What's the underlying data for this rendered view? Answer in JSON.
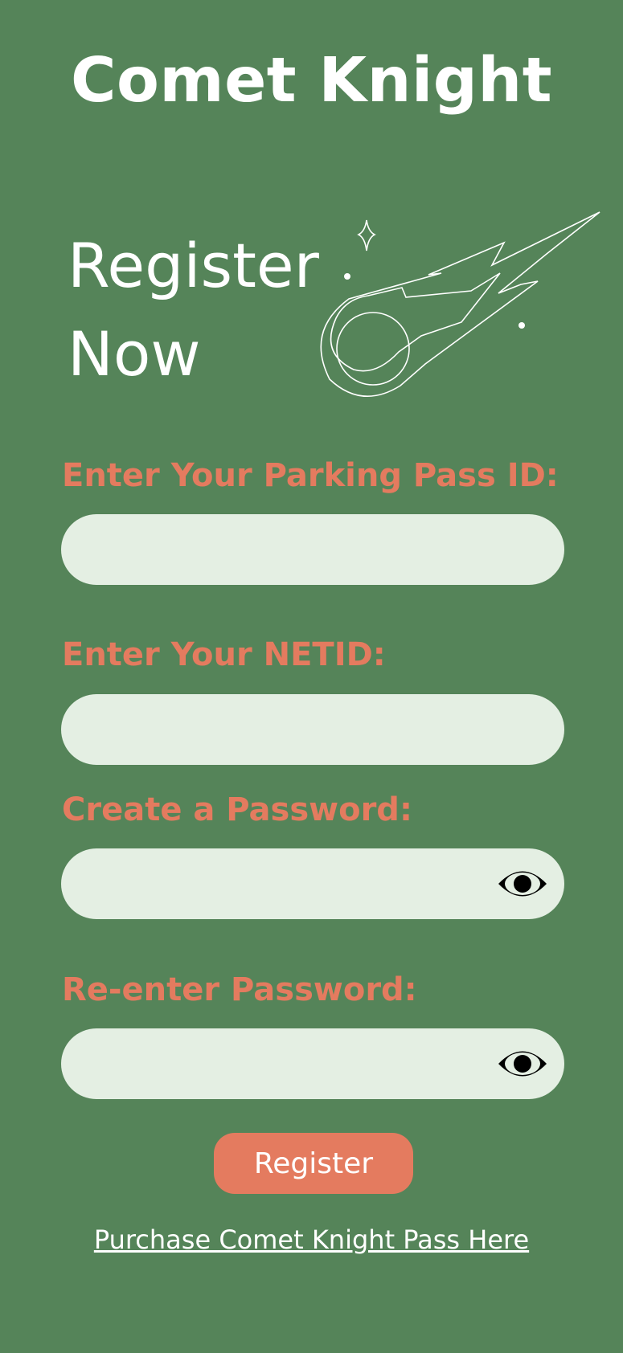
{
  "app": {
    "title": "Comet Knight"
  },
  "hero": {
    "heading": "Register Now",
    "illustration": "comet-icon"
  },
  "form": {
    "parking_pass": {
      "label": "Enter Your Parking Pass ID:",
      "value": "",
      "placeholder": ""
    },
    "netid": {
      "label": "Enter Your NETID:",
      "value": "",
      "placeholder": ""
    },
    "password": {
      "label": "Create a Password:",
      "value": "",
      "placeholder": "",
      "toggle_icon": "eye-icon"
    },
    "confirm_password": {
      "label": "Re-enter Password:",
      "value": "",
      "placeholder": "",
      "toggle_icon": "eye-icon"
    },
    "register_label": "Register",
    "purchase_link": "Purchase Comet Knight Pass Here"
  },
  "colors": {
    "background": "#558459",
    "accent": "#e47b5f",
    "field_bg": "#e4efe3",
    "text_light": "#ffffff"
  }
}
